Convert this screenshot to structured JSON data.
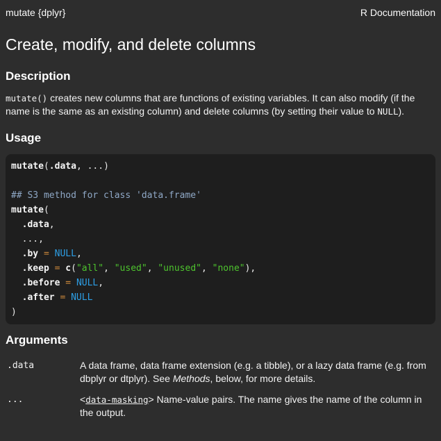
{
  "header": {
    "left": "mutate {dplyr}",
    "right": "R Documentation"
  },
  "title": "Create, modify, and delete columns",
  "section_headings": {
    "description": "Description",
    "usage": "Usage",
    "arguments": "Arguments"
  },
  "description": {
    "tokens": [
      {
        "t": "mutate()",
        "s": "code"
      },
      {
        "t": " creates new columns that are functions of existing variables. It can also modify (if the name is the same as an existing column) and delete columns (by setting their value to ",
        "s": "plain"
      },
      {
        "t": "NULL",
        "s": "code"
      },
      {
        "t": ").",
        "s": "plain"
      }
    ]
  },
  "usage_code": {
    "token_colors": {
      "id": "#f5f5f5",
      "pl": "#e8e8e8",
      "cm": "#8fa8c6",
      "op": "#cf8a3b",
      "kw": "#2d9fe6",
      "st": "#4ec42e"
    },
    "bold_tokens": [
      "id"
    ],
    "lines": [
      [
        {
          "t": "mutate",
          "s": "id"
        },
        {
          "t": "(",
          "s": "pl"
        },
        {
          "t": ".data",
          "s": "id"
        },
        {
          "t": ", ...)",
          "s": "pl"
        }
      ],
      [],
      [
        {
          "t": "## S3 method for class 'data.frame'",
          "s": "cm"
        }
      ],
      [
        {
          "t": "mutate",
          "s": "id"
        },
        {
          "t": "(",
          "s": "pl"
        }
      ],
      [
        {
          "t": "  ",
          "s": "pl"
        },
        {
          "t": ".data",
          "s": "id"
        },
        {
          "t": ",",
          "s": "pl"
        }
      ],
      [
        {
          "t": "  ...,",
          "s": "pl"
        }
      ],
      [
        {
          "t": "  ",
          "s": "pl"
        },
        {
          "t": ".by",
          "s": "id"
        },
        {
          "t": " ",
          "s": "pl"
        },
        {
          "t": "=",
          "s": "op"
        },
        {
          "t": " ",
          "s": "pl"
        },
        {
          "t": "NULL",
          "s": "kw"
        },
        {
          "t": ",",
          "s": "pl"
        }
      ],
      [
        {
          "t": "  ",
          "s": "pl"
        },
        {
          "t": ".keep",
          "s": "id"
        },
        {
          "t": " ",
          "s": "pl"
        },
        {
          "t": "=",
          "s": "op"
        },
        {
          "t": " ",
          "s": "pl"
        },
        {
          "t": "c",
          "s": "id"
        },
        {
          "t": "(",
          "s": "pl"
        },
        {
          "t": "\"all\"",
          "s": "st"
        },
        {
          "t": ", ",
          "s": "pl"
        },
        {
          "t": "\"used\"",
          "s": "st"
        },
        {
          "t": ", ",
          "s": "pl"
        },
        {
          "t": "\"unused\"",
          "s": "st"
        },
        {
          "t": ", ",
          "s": "pl"
        },
        {
          "t": "\"none\"",
          "s": "st"
        },
        {
          "t": "),",
          "s": "pl"
        }
      ],
      [
        {
          "t": "  ",
          "s": "pl"
        },
        {
          "t": ".before",
          "s": "id"
        },
        {
          "t": " ",
          "s": "pl"
        },
        {
          "t": "=",
          "s": "op"
        },
        {
          "t": " ",
          "s": "pl"
        },
        {
          "t": "NULL",
          "s": "kw"
        },
        {
          "t": ",",
          "s": "pl"
        }
      ],
      [
        {
          "t": "  ",
          "s": "pl"
        },
        {
          "t": ".after",
          "s": "id"
        },
        {
          "t": " ",
          "s": "pl"
        },
        {
          "t": "=",
          "s": "op"
        },
        {
          "t": " ",
          "s": "pl"
        },
        {
          "t": "NULL",
          "s": "kw"
        }
      ],
      [
        {
          "t": ")",
          "s": "pl"
        }
      ]
    ]
  },
  "arguments": [
    {
      "term": ".data",
      "tokens": [
        {
          "t": "A data frame, data frame extension (e.g. a tibble), or a lazy data frame (e.g. from dbplyr or dtplyr). See ",
          "s": "plain"
        },
        {
          "t": "Methods",
          "s": "i"
        },
        {
          "t": ", below, for more details.",
          "s": "plain"
        }
      ]
    },
    {
      "term": "...",
      "tokens": [
        {
          "t": "<",
          "s": "plain"
        },
        {
          "t": "data-masking",
          "s": "codelink"
        },
        {
          "t": "> Name-value pairs. The name gives the name of the column in the output.",
          "s": "plain"
        }
      ]
    }
  ]
}
